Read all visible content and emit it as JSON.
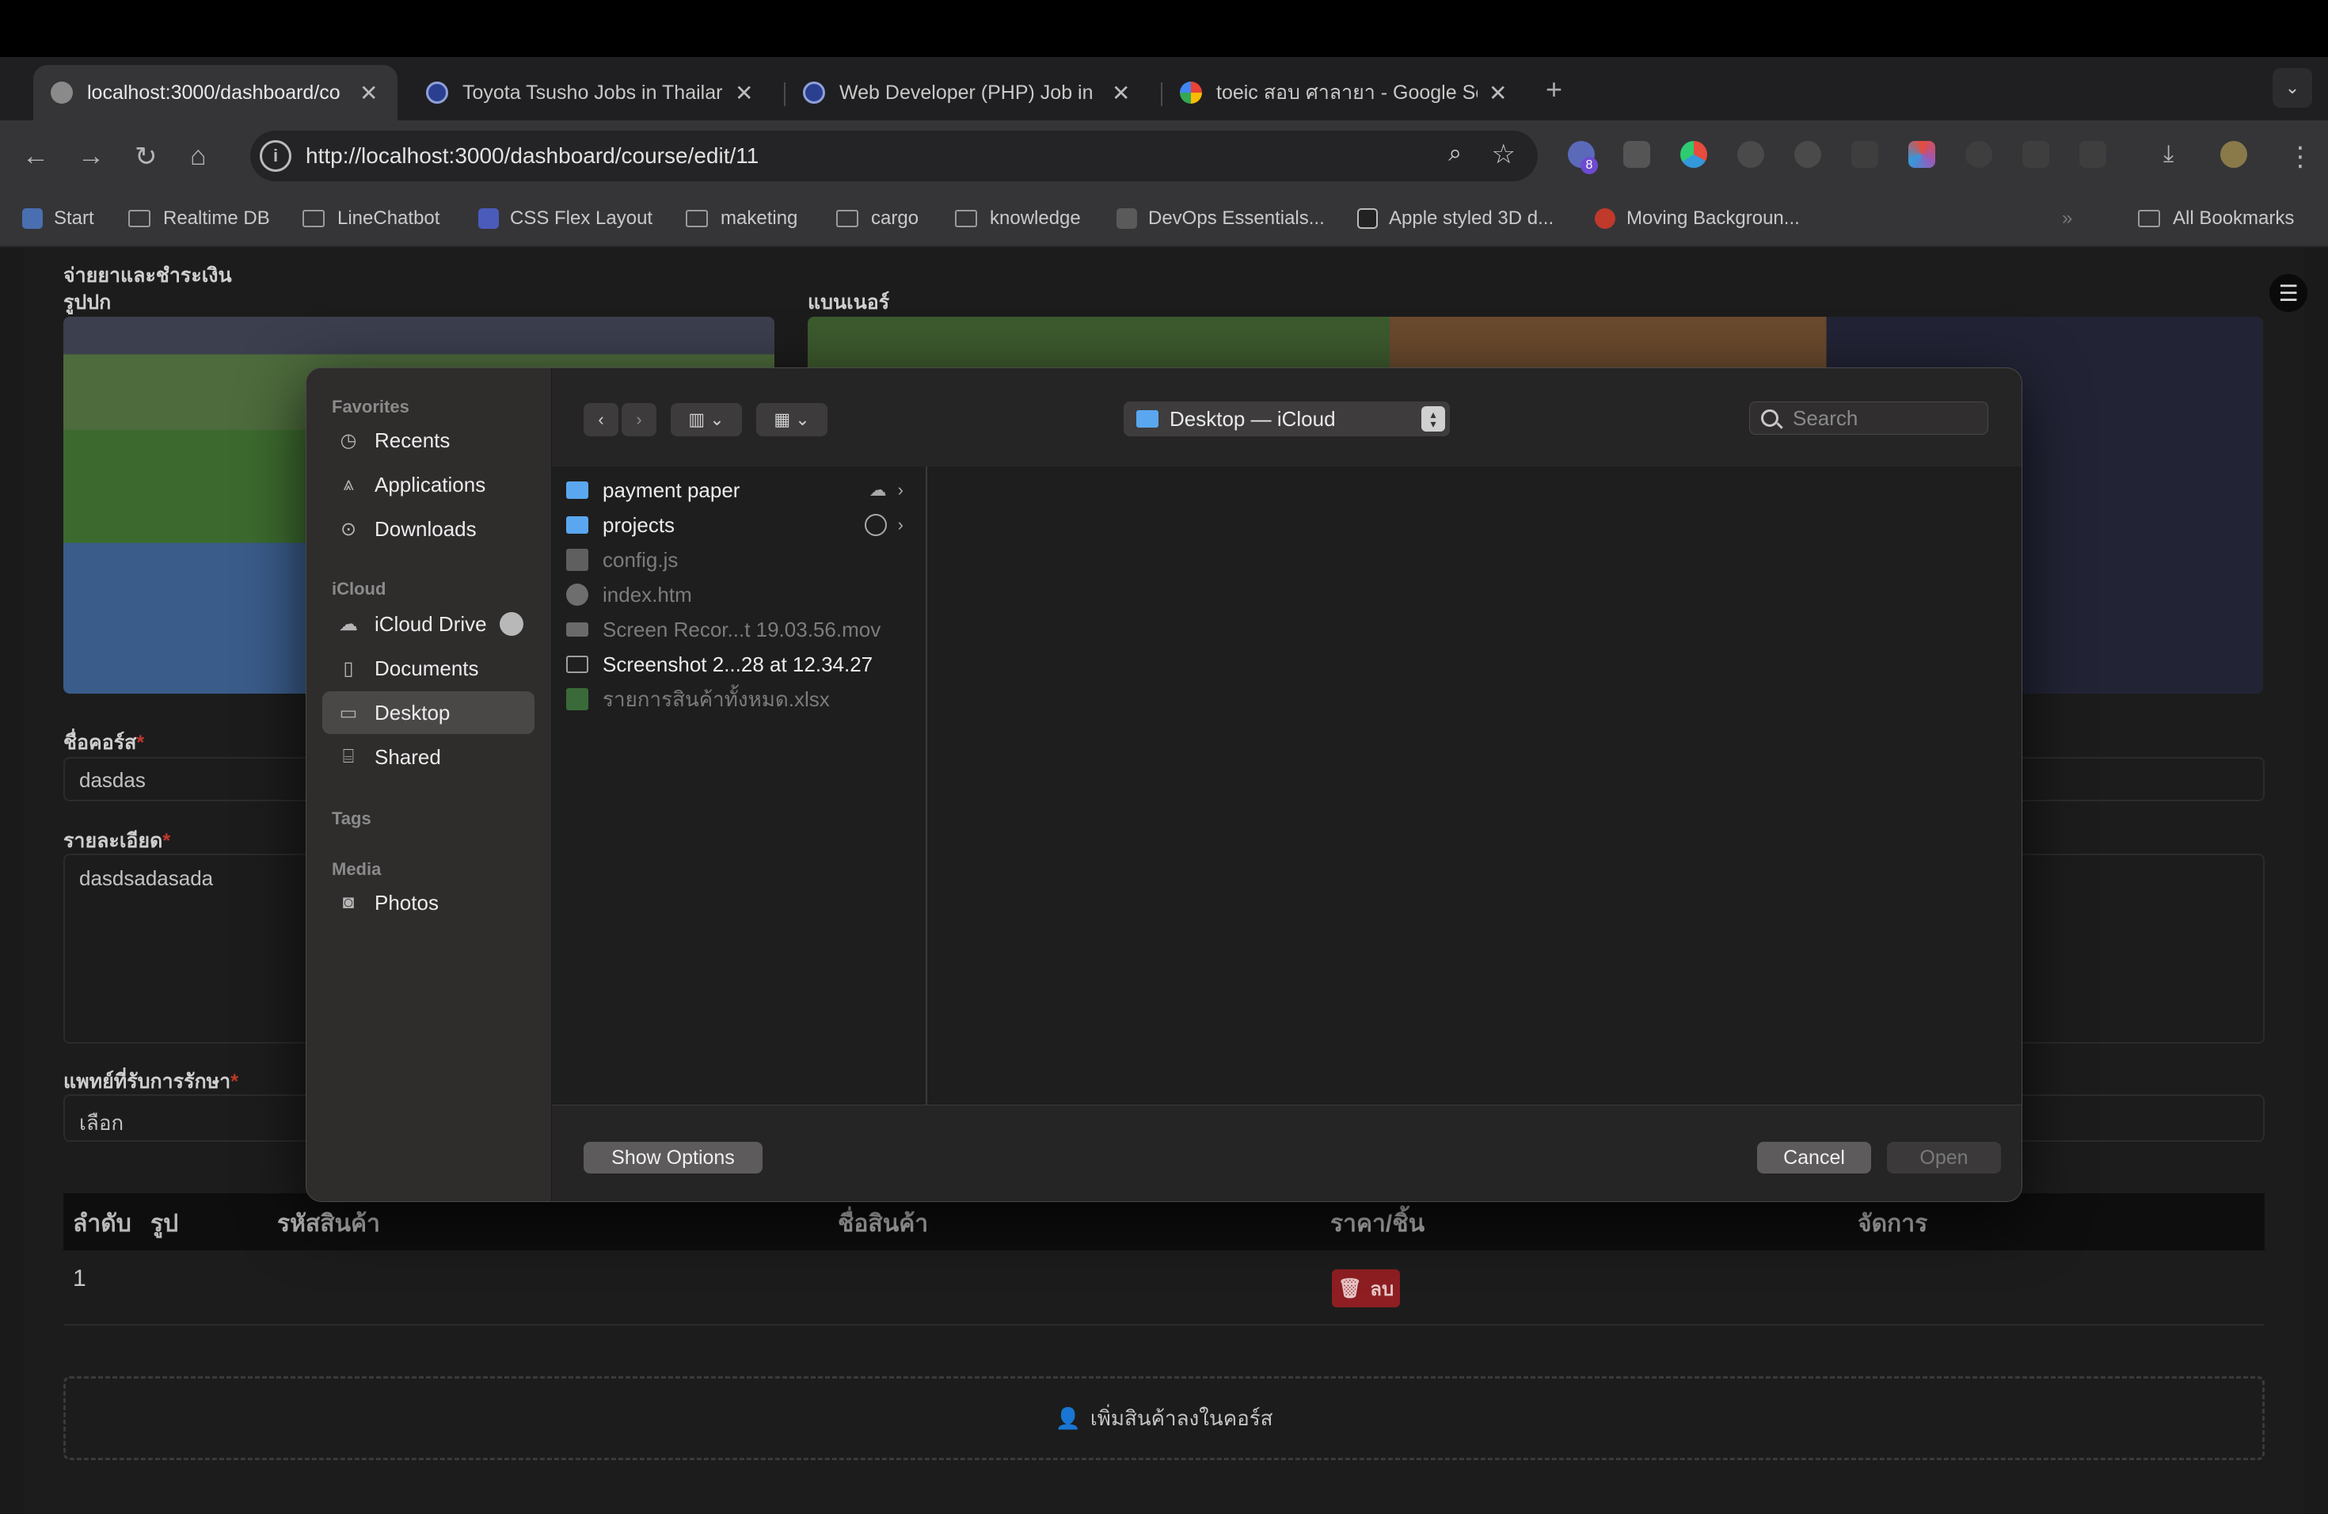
{
  "browser": {
    "tabs": [
      {
        "title": "localhost:3000/dashboard/co",
        "favicon_color": "#8a8a8a"
      },
      {
        "title": "Toyota Tsusho Jobs in Thailar",
        "favicon_color": "#2a3f8f"
      },
      {
        "title": "Web Developer (PHP) Job in",
        "favicon_color": "#2a3f8f"
      },
      {
        "title": "toeic สอบ ศาลายา - Google Se",
        "favicon_color": "#4285f4"
      }
    ],
    "close_glyph": "✕",
    "new_tab_glyph": "+",
    "url": "http://localhost:3000/dashboard/course/edit/11",
    "extension_badge": "8",
    "bookmarks": [
      {
        "label": "Start",
        "kind": "icon"
      },
      {
        "label": "Realtime DB",
        "kind": "folder"
      },
      {
        "label": "LineChatbot",
        "kind": "folder"
      },
      {
        "label": "CSS Flex Layout",
        "kind": "icon"
      },
      {
        "label": "maketing",
        "kind": "folder"
      },
      {
        "label": "cargo",
        "kind": "folder"
      },
      {
        "label": "knowledge",
        "kind": "folder"
      },
      {
        "label": "DevOps Essentials...",
        "kind": "icon"
      },
      {
        "label": "Apple styled 3D d...",
        "kind": "icon"
      },
      {
        "label": "Moving Backgroun...",
        "kind": "icon"
      }
    ],
    "all_bookmarks": "All Bookmarks"
  },
  "page": {
    "section_title_line1": "จ่ายยาและชำระเงิน",
    "thumbnail_label": "รูปปก",
    "banner_label": "แบนเนอร์",
    "course_name_label": "ชื่อคอร์ส",
    "course_name_value": "dasdas",
    "detail_label": "รายละเอียด",
    "detail_value": "dasdsadasada",
    "doctor_label": "แพทย์ที่รับการรักษา",
    "doctor_value": "เลือก",
    "required_mark": "*",
    "table": {
      "headers": [
        "ลำดับ",
        "รูป",
        "รหัสสินค้า",
        "ชื่อสินค้า",
        "ราคา/ชิ้น",
        "จัดการ"
      ],
      "rows": [
        {
          "index": "1",
          "delete_label": "ลบ"
        }
      ]
    },
    "add_product_label": "เพิ่มสินค้าลงในคอร์ส"
  },
  "dialog": {
    "sidebar": {
      "favorites_heading": "Favorites",
      "favorites": [
        "Recents",
        "Applications",
        "Downloads"
      ],
      "icloud_heading": "iCloud",
      "icloud": [
        "iCloud Drive",
        "Documents",
        "Desktop",
        "Shared"
      ],
      "selected": "Desktop",
      "tags_heading": "Tags",
      "media_heading": "Media",
      "media": [
        "Photos"
      ]
    },
    "location": "Desktop — iCloud",
    "search_placeholder": "Search",
    "files": [
      {
        "name": "payment paper",
        "type": "folder",
        "dim": false,
        "status": "cloud-upload"
      },
      {
        "name": "projects",
        "type": "folder",
        "dim": false,
        "status": "syncing"
      },
      {
        "name": "config.js",
        "type": "doc",
        "dim": true
      },
      {
        "name": "index.htm",
        "type": "htm",
        "dim": true
      },
      {
        "name": "Screen Recor...t 19.03.56.mov",
        "type": "mov",
        "dim": true
      },
      {
        "name": "Screenshot 2...28 at 12.34.27",
        "type": "img",
        "dim": false
      },
      {
        "name": "รายการสินค้าทั้งหมด.xlsx",
        "type": "xls",
        "dim": true
      }
    ],
    "buttons": {
      "show_options": "Show Options",
      "cancel": "Cancel",
      "open": "Open"
    }
  }
}
